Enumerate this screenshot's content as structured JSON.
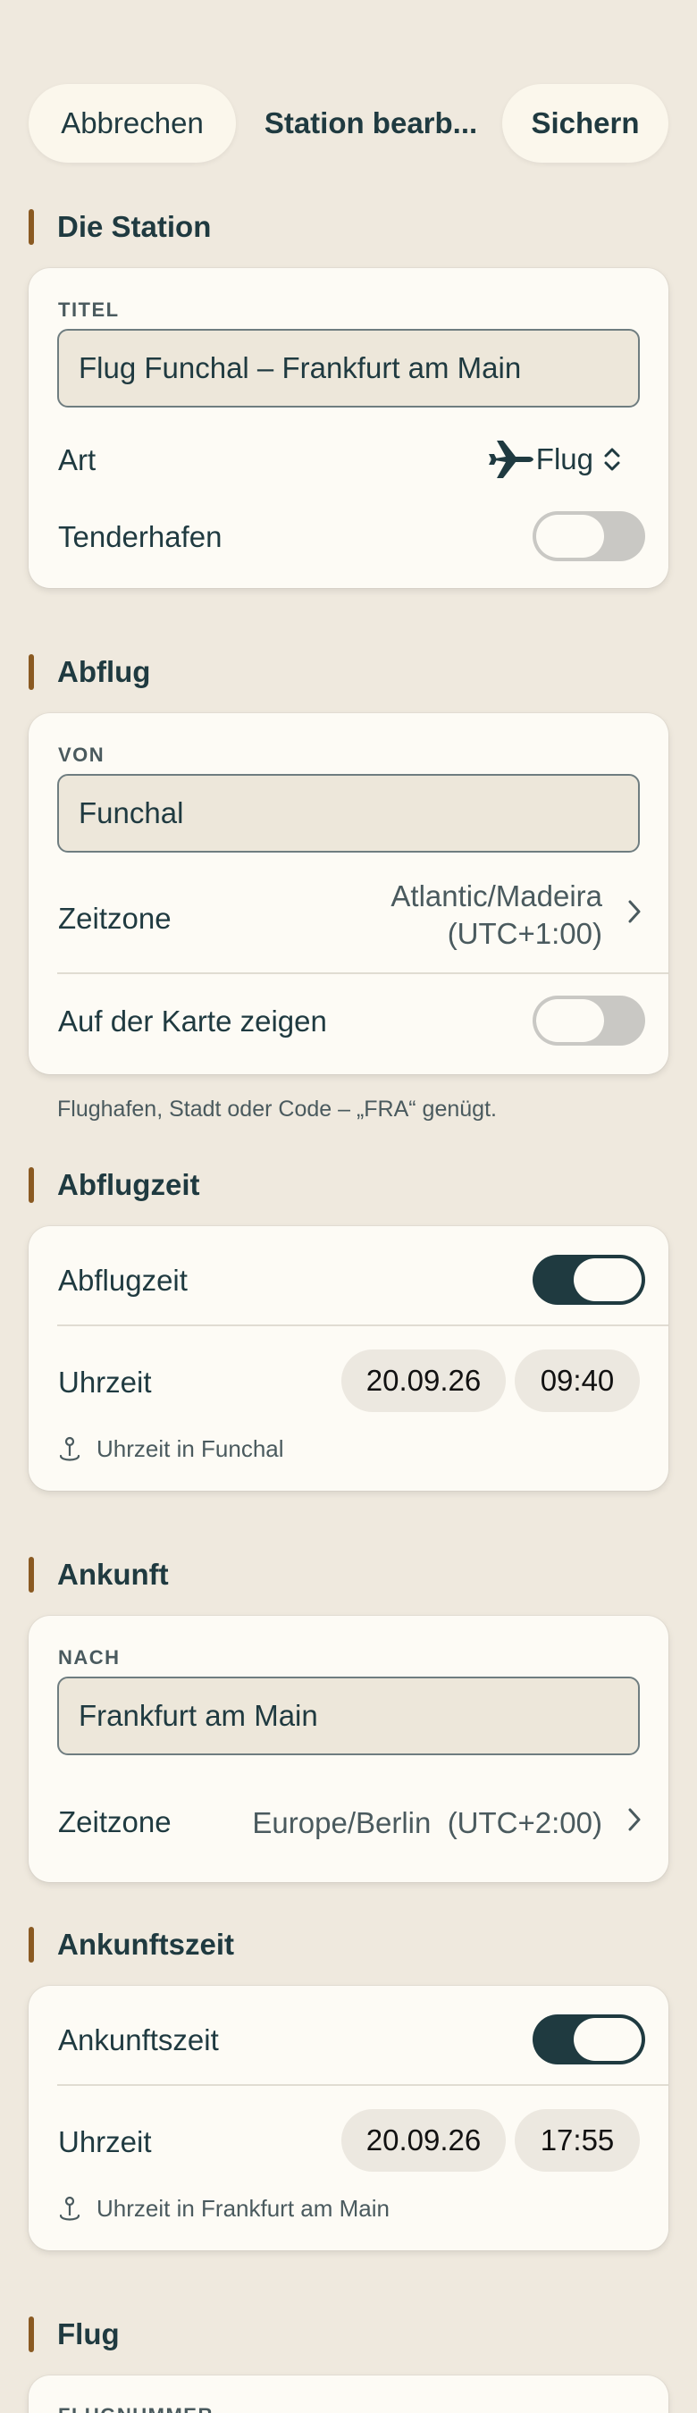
{
  "nav": {
    "cancel_label": "Abbrechen",
    "title": "Station bearb...",
    "save_label": "Sichern"
  },
  "station": {
    "section_title": "Die Station",
    "title_label": "TITEL",
    "title_value": "Flug Funchal – Frankfurt am Main",
    "type_label": "Art",
    "type_value": "Flug",
    "tender_label": "Tenderhafen",
    "tender_on": false
  },
  "departure": {
    "section_title": "Abflug",
    "from_label": "VON",
    "from_value": "Funchal",
    "timezone_label": "Zeitzone",
    "timezone_line1": "Atlantic/Madeira",
    "timezone_line2": "(UTC+1:00)",
    "map_label": "Auf der Karte zeigen",
    "map_on": false,
    "hint": "Flughafen, Stadt oder Code – „FRA“ genügt."
  },
  "departure_time": {
    "section_title": "Abflugzeit",
    "toggle_label": "Abflugzeit",
    "toggle_on": true,
    "time_label": "Uhrzeit",
    "date": "20.09.26",
    "time": "09:40",
    "note": "Uhrzeit in Funchal"
  },
  "arrival": {
    "section_title": "Ankunft",
    "to_label": "NACH",
    "to_value": "Frankfurt am Main",
    "timezone_label": "Zeitzone",
    "timezone_value": "Europe/Berlin  (UTC+2:00)"
  },
  "arrival_time": {
    "section_title": "Ankunftszeit",
    "toggle_label": "Ankunftszeit",
    "toggle_on": true,
    "time_label": "Uhrzeit",
    "date": "20.09.26",
    "time": "17:55",
    "note": "Uhrzeit in Frankfurt am Main"
  },
  "flight": {
    "section_title": "Flug",
    "number_label": "FLUGNUMMER"
  },
  "colors": {
    "background": "#efe9de",
    "card": "#fdfbf5",
    "accent_bar": "#8a5a22",
    "text_primary": "#1f3a40",
    "toggle_on": "#1f3a40",
    "toggle_off": "#c9c8c4"
  },
  "icons": {
    "type_icon": "airplane-icon",
    "type_chevron": "up-down-chevron-icon",
    "timezone_chevron": "chevron-right-icon",
    "note_icon": "pin-icon"
  }
}
